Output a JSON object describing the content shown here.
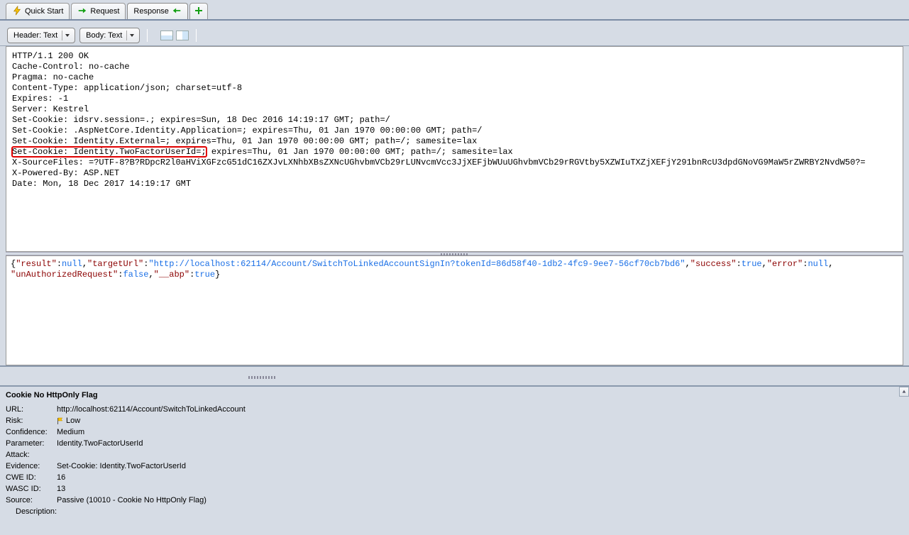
{
  "tabs": {
    "quick_start": "Quick Start",
    "request": "Request",
    "response": "Response"
  },
  "toolbar": {
    "header_dropdown": "Header: Text",
    "body_dropdown": "Body: Text"
  },
  "headers": {
    "l1": "HTTP/1.1 200 OK",
    "l2": "Cache-Control: no-cache",
    "l3": "Pragma: no-cache",
    "l4": "Content-Type: application/json; charset=utf-8",
    "l5": "Expires: -1",
    "l6": "Server: Kestrel",
    "l7": "Set-Cookie: idsrv.session=.; expires=Sun, 18 Dec 2016 14:19:17 GMT; path=/",
    "l8": "Set-Cookie: .AspNetCore.Identity.Application=; expires=Thu, 01 Jan 1970 00:00:00 GMT; path=/",
    "l9": "Set-Cookie: Identity.External=; expires=Thu, 01 Jan 1970 00:00:00 GMT; path=/; samesite=lax",
    "l10a": "Set-Cookie: Identity.TwoFactorUserId=;",
    "l10b": " expires=Thu, 01 Jan 1970 00:00:00 GMT; path=/; samesite=lax",
    "l11": "X-SourceFiles: =?UTF-8?B?RDpcR2l0aHViXGFzcG51dC16ZXJvLXNhbXBsZXNcUGhvbmVCb29rLUNvcmVcc3JjXEFjbWUuUGhvbmVCb29rRGVtby5XZWIuTXZjXEFjY291bnRcU3dpdGNoVG9MaW5rZWRBY2NvdW50?=",
    "l12": "X-Powered-By: ASP.NET",
    "l13": "Date: Mon, 18 Dec 2017 14:19:17 GMT"
  },
  "body_json": {
    "k_result": "\"result\"",
    "v_result": "null",
    "k_targetUrl": "\"targetUrl\"",
    "v_targetUrl": "\"http://localhost:62114/Account/SwitchToLinkedAccountSignIn?tokenId=86d58f40-1db2-4fc9-9ee7-56cf70cb7bd6\"",
    "k_success": "\"success\"",
    "v_success": "true",
    "k_error": "\"error\"",
    "v_error": "null",
    "k_unAuth": "\"unAuthorizedRequest\"",
    "v_unAuth": "false",
    "k_abp": "\"__abp\"",
    "v_abp": "true"
  },
  "alert": {
    "title": "Cookie No HttpOnly Flag",
    "url_label": "URL:",
    "url": "http://localhost:62114/Account/SwitchToLinkedAccount",
    "risk_label": "Risk:",
    "risk": "Low",
    "confidence_label": "Confidence:",
    "confidence": "Medium",
    "parameter_label": "Parameter:",
    "parameter": "Identity.TwoFactorUserId",
    "attack_label": "Attack:",
    "attack": "",
    "evidence_label": "Evidence:",
    "evidence": "Set-Cookie: Identity.TwoFactorUserId",
    "cwe_label": "CWE ID:",
    "cwe": "16",
    "wasc_label": "WASC ID:",
    "wasc": "13",
    "source_label": "Source:",
    "source": "Passive (10010 - Cookie No HttpOnly Flag)",
    "description_label": "Description:"
  }
}
